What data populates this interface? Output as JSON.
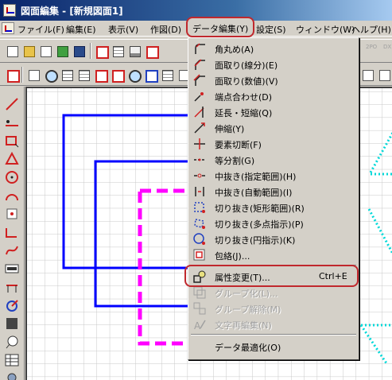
{
  "window": {
    "title": "図面編集 - [新規図面1]"
  },
  "menubar": {
    "items": [
      {
        "label": "ファイル(F)"
      },
      {
        "label": "編集(E)"
      },
      {
        "label": "表示(V)"
      },
      {
        "label": "作図(D)"
      },
      {
        "label": "データ編集(Y)"
      },
      {
        "label": "設定(S)"
      },
      {
        "label": "ウィンドウ(W)"
      },
      {
        "label": "ヘルプ(H)"
      }
    ],
    "active_label": "データ編集(Y)"
  },
  "toolbar": {
    "disabled_labels": [
      "2PO",
      "DX"
    ]
  },
  "dropdown": {
    "items": [
      {
        "label": "角丸め(A)",
        "icon": "round-corner-icon",
        "enabled": true
      },
      {
        "label": "面取り(線分)(E)",
        "icon": "chamfer-line-icon",
        "enabled": true
      },
      {
        "label": "面取り(数値)(V)",
        "icon": "chamfer-value-icon",
        "enabled": true
      },
      {
        "label": "端点合わせ(D)",
        "icon": "endpoint-align-icon",
        "enabled": true
      },
      {
        "label": "延長・短縮(Q)",
        "icon": "extend-shorten-icon",
        "enabled": true
      },
      {
        "label": "伸縮(Y)",
        "icon": "stretch-icon",
        "enabled": true
      },
      {
        "label": "要素切断(F)",
        "icon": "element-cut-icon",
        "enabled": true
      },
      {
        "label": "等分割(G)",
        "icon": "equal-divide-icon",
        "enabled": true
      },
      {
        "label": "中抜き(指定範囲)(H)",
        "icon": "hollow-range-icon",
        "enabled": true
      },
      {
        "label": "中抜き(自動範囲)(I)",
        "icon": "hollow-auto-icon",
        "enabled": true
      },
      {
        "label": "切り抜き(矩形範囲)(R)",
        "icon": "crop-rect-icon",
        "enabled": true
      },
      {
        "label": "切り抜き(多点指示)(P)",
        "icon": "crop-polygon-icon",
        "enabled": true
      },
      {
        "label": "切り抜き(円指示)(K)",
        "icon": "crop-circle-icon",
        "enabled": true
      },
      {
        "label": "包絡(J)...",
        "icon": "envelope-icon",
        "enabled": true
      },
      {
        "label": "属性変更(T)...",
        "shortcut": "Ctrl+E",
        "icon": "attribute-change-icon",
        "enabled": true
      },
      {
        "label": "グループ化(L)...",
        "icon": "group-icon",
        "enabled": false
      },
      {
        "label": "グループ解除(M)",
        "icon": "ungroup-icon",
        "enabled": false
      },
      {
        "label": "文字再編集(N)",
        "icon": "text-reedit-icon",
        "enabled": false
      },
      {
        "label": "データ最適化(O)",
        "icon": "",
        "enabled": true
      }
    ]
  },
  "colors": {
    "menu_highlight_ring": "#c0282d",
    "shape_blue": "#0000ff",
    "shape_magenta": "#ff00ff",
    "shape_cyan": "#00d8d8",
    "grid": "#c8c8c8"
  }
}
